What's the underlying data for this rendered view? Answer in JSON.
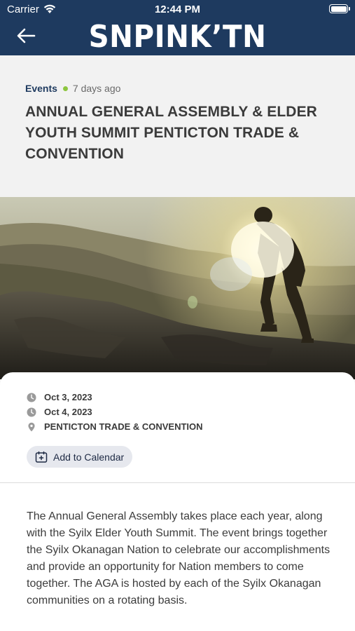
{
  "status_bar": {
    "carrier": "Carrier",
    "time": "12:44 PM",
    "icons": [
      "wifi-icon",
      "battery-icon"
    ]
  },
  "nav": {
    "back_icon": "arrow-left-icon",
    "brand": "SNPINK’TN"
  },
  "article": {
    "category": "Events",
    "posted": "7 days ago",
    "title": "ANNUAL GENERAL ASSEMBLY & ELDER YOUTH SUMMIT PENTICTON TRADE & CONVENTION",
    "hero_image": "hiker-silhouette-at-sunrise-on-mountain"
  },
  "details": {
    "start_date": "Oct 3, 2023",
    "end_date": "Oct 4, 2023",
    "location": "PENTICTON TRADE & CONVENTION",
    "add_to_calendar": "Add to Calendar",
    "description": "The Annual General Assembly takes place each year, along with the Syilx Elder Youth Summit. The event brings together the Syilx Okanagan Nation to celebrate our accomplishments and provide an opportunity for Nation members to come together. The AGA is hosted by each of the Syilx Okanagan communities on a rotating basis."
  },
  "colors": {
    "header": "#1e3a5f",
    "accent_dot": "#8dc63f",
    "title_text": "#3b3b3b",
    "calendar_button_bg": "#e6e8ee"
  }
}
